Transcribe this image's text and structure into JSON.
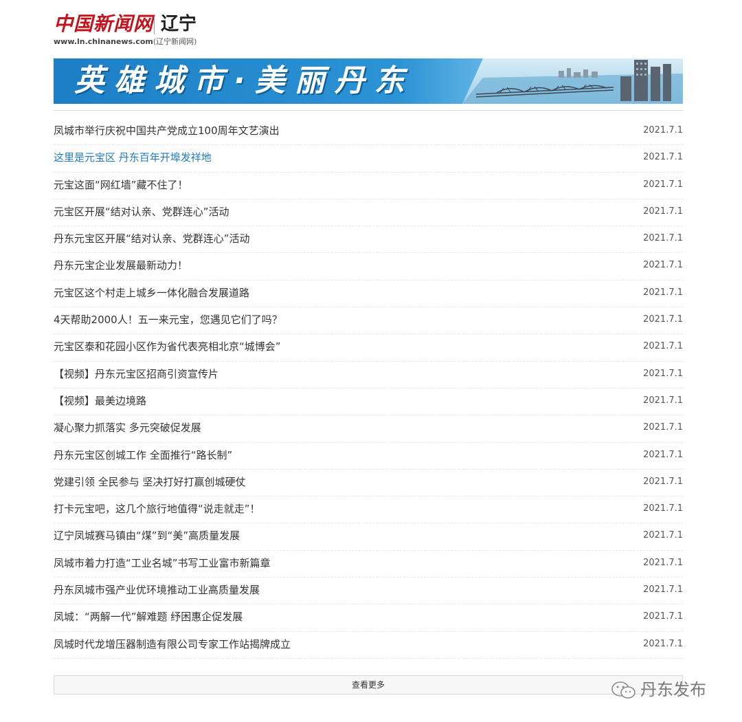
{
  "header": {
    "logo_text": "中国新闻网",
    "region": "辽宁",
    "url_text": "www.ln.chinanews.com",
    "url_suffix": "(辽宁新闻网)"
  },
  "banner": {
    "text": "英雄城市·美丽丹东"
  },
  "news": [
    {
      "title": "凤城市举行庆祝中国共产党成立100周年文艺演出",
      "date": "2021.7.1"
    },
    {
      "title": "这里是元宝区 丹东百年开埠发祥地",
      "date": "2021.7.1"
    },
    {
      "title": "元宝这面“网红墙”藏不住了！",
      "date": "2021.7.1"
    },
    {
      "title": "元宝区开展“结对认亲、党群连心”活动",
      "date": "2021.7.1"
    },
    {
      "title": "丹东元宝区开展“结对认亲、党群连心”活动",
      "date": "2021.7.1"
    },
    {
      "title": "丹东元宝企业发展最新动力！",
      "date": "2021.7.1"
    },
    {
      "title": "元宝区这个村走上城乡一体化融合发展道路",
      "date": "2021.7.1"
    },
    {
      "title": "4天帮助2000人！五一来元宝，您遇见它们了吗？",
      "date": "2021.7.1"
    },
    {
      "title": "元宝区泰和花园小区作为省代表亮相北京“城博会”",
      "date": "2021.7.1"
    },
    {
      "title": "【视频】丹东元宝区招商引资宣传片",
      "date": "2021.7.1"
    },
    {
      "title": "【视频】最美边境路",
      "date": "2021.7.1"
    },
    {
      "title": "凝心聚力抓落实 多元突破促发展",
      "date": "2021.7.1"
    },
    {
      "title": "丹东元宝区创城工作 全面推行“路长制”",
      "date": "2021.7.1"
    },
    {
      "title": "党建引领 全民参与 坚决打好打赢创城硬仗",
      "date": "2021.7.1"
    },
    {
      "title": "打卡元宝吧，这几个旅行地值得“说走就走”！",
      "date": "2021.7.1"
    },
    {
      "title": "辽宁凤城赛马镇由“煤”到“美”高质量发展",
      "date": "2021.7.1"
    },
    {
      "title": "凤城市着力打造“工业名城”书写工业富市新篇章",
      "date": "2021.7.1"
    },
    {
      "title": "丹东凤城市强产业优环境推动工业高质量发展",
      "date": "2021.7.1"
    },
    {
      "title": "凤城：“两解一代”解难题 纾困惠企促发展",
      "date": "2021.7.1"
    },
    {
      "title": "凤城时代龙增压器制造有限公司专家工作站揭牌成立",
      "date": "2021.7.1"
    }
  ],
  "more_button": "查看更多",
  "watermark": {
    "text": "丹东发布",
    "icon": "wechat-icon"
  },
  "colors": {
    "logo_red": "#c3131c",
    "banner_blue": "#1c7fc6",
    "link_highlight": "#1f7ac4"
  }
}
